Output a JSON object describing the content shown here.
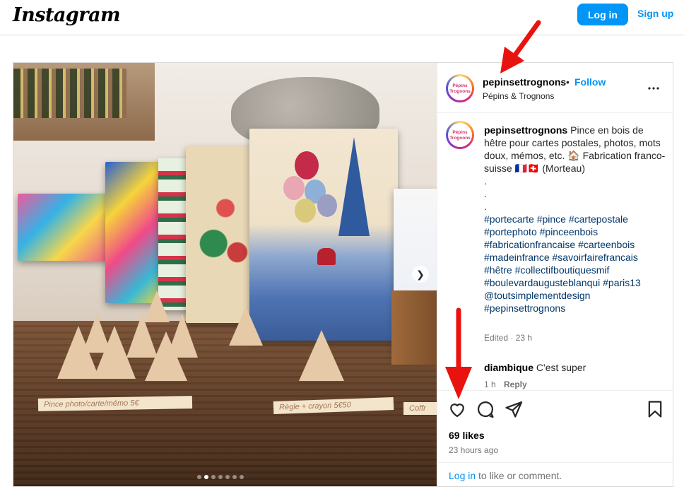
{
  "header": {
    "logo": "Instagram",
    "login_label": "Log in",
    "signup_label": "Sign up"
  },
  "media": {
    "tags": [
      "Pince photo/carte/mémo 5€",
      "Règle + crayon 5€50",
      "Coffr"
    ],
    "carousel_total": 7,
    "carousel_active_index": 1
  },
  "post": {
    "username": "pepinsettrognons",
    "separator": "•",
    "follow_label": "Follow",
    "subtitle": "Pépins & Trognons",
    "avatar_text": "Pépins Trognons",
    "caption": {
      "text_lines": [
        "Pince en bois de hêtre pour cartes postales, photos, mots doux, mémos, etc. 🏠",
        "Fabrication franco-suisse 🇫🇷🇨🇭 (Morteau)"
      ],
      "dots": [
        ".",
        ".",
        "."
      ],
      "hashtags": "#portecarte #pince #cartepostale #portephoto #pinceenbois #fabricationfrancaise #carteenbois #madeinfrance #savoirfairefrancais #hêtre #collectifboutiquesmif #boulevardaugusteblanqui #paris13 @toutsimplementdesign #pepinsettrognons"
    },
    "edited": "Edited · 23 h",
    "comment": {
      "username": "diambique",
      "text": "C'est super",
      "time": "1 h",
      "reply_label": "Reply"
    },
    "likes": "69 likes",
    "timestamp": "23 hours ago",
    "login_prompt": {
      "link": "Log in",
      "text": "to like or comment."
    }
  },
  "colors": {
    "accent": "#0095f6",
    "annotation_arrow": "#e8130f",
    "hashtag": "#00376b",
    "muted": "#737373"
  },
  "icons": [
    "more-icon",
    "heart-icon",
    "comment-icon",
    "share-icon",
    "save-icon",
    "chevron-right-icon"
  ]
}
